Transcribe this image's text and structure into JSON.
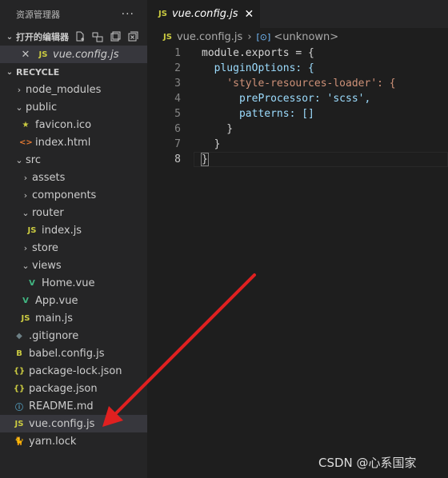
{
  "sidebar": {
    "title": "资源管理器",
    "more": "···",
    "open_editors": {
      "label": "打开的编辑器",
      "files": [
        {
          "close": "✕",
          "icon": "JS",
          "name": "vue.config.js"
        }
      ]
    },
    "project": {
      "label": "RECYCLE",
      "tree": [
        {
          "name": "node_modules",
          "icon": "",
          "chev": "›",
          "indent": 1
        },
        {
          "name": "public",
          "icon": "",
          "chev": "⌄",
          "indent": 1
        },
        {
          "name": "favicon.ico",
          "icon": "★",
          "chev": "",
          "indent": 2
        },
        {
          "name": "index.html",
          "icon": "<>",
          "chev": "",
          "indent": 2
        },
        {
          "name": "src",
          "icon": "",
          "chev": "⌄",
          "indent": 1
        },
        {
          "name": "assets",
          "icon": "",
          "chev": "›",
          "indent": 2
        },
        {
          "name": "components",
          "icon": "",
          "chev": "›",
          "indent": 2
        },
        {
          "name": "router",
          "icon": "",
          "chev": "⌄",
          "indent": 2
        },
        {
          "name": "index.js",
          "icon": "JS",
          "chev": "",
          "indent": 3
        },
        {
          "name": "store",
          "icon": "",
          "chev": "›",
          "indent": 2
        },
        {
          "name": "views",
          "icon": "",
          "chev": "⌄",
          "indent": 2
        },
        {
          "name": "Home.vue",
          "icon": "V",
          "chev": "",
          "indent": 3
        },
        {
          "name": "App.vue",
          "icon": "V",
          "chev": "",
          "indent": 2
        },
        {
          "name": "main.js",
          "icon": "JS",
          "chev": "",
          "indent": 2
        },
        {
          "name": ".gitignore",
          "icon": "◆",
          "chev": "",
          "indent": 1
        },
        {
          "name": "babel.config.js",
          "icon": "B",
          "chev": "",
          "indent": 1
        },
        {
          "name": "package-lock.json",
          "icon": "{}",
          "chev": "",
          "indent": 1
        },
        {
          "name": "package.json",
          "icon": "{}",
          "chev": "",
          "indent": 1
        },
        {
          "name": "README.md",
          "icon": "ⓘ",
          "chev": "",
          "indent": 1
        },
        {
          "name": "vue.config.js",
          "icon": "JS",
          "chev": "",
          "indent": 1,
          "selected": true
        },
        {
          "name": "yarn.lock",
          "icon": "🐈",
          "chev": "",
          "indent": 1
        }
      ]
    }
  },
  "editor": {
    "tab": {
      "icon": "JS",
      "label": "vue.config.js",
      "close": "✕"
    },
    "breadcrumb": {
      "icon": "JS",
      "file": "vue.config.js",
      "sep": "›",
      "symbol_icon": "[⊙]",
      "symbol": "<unknown>"
    },
    "line_numbers": [
      "1",
      "2",
      "3",
      "4",
      "5",
      "6",
      "7",
      "8"
    ],
    "code": [
      "module.exports = {",
      "  pluginOptions: {",
      "    'style-resources-loader': {",
      "      preProcessor: 'scss',",
      "      patterns: []",
      "    }",
      "  }",
      "}"
    ]
  },
  "watermark": "CSDN @心系国家",
  "colors": {
    "accent_arrow": "#e02020",
    "sidebar_bg": "#252526",
    "editor_bg": "#1e1e1e"
  }
}
